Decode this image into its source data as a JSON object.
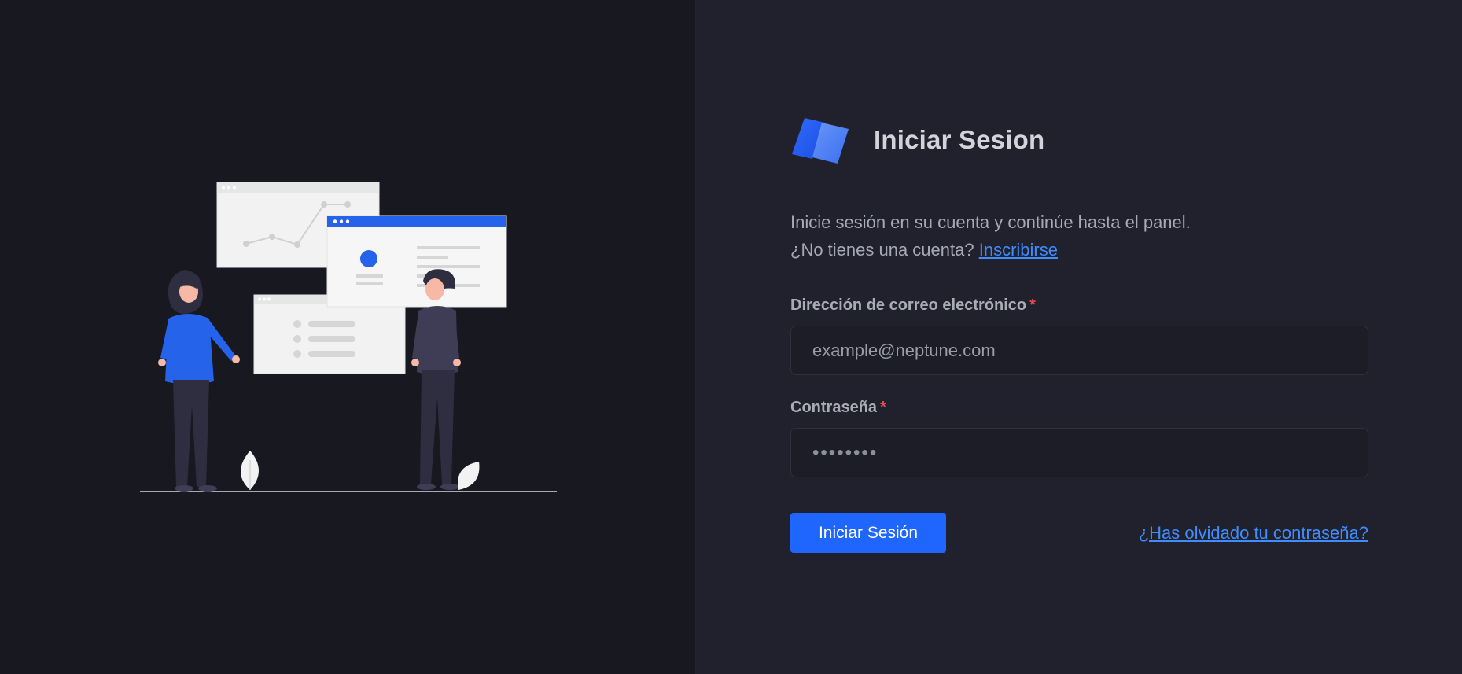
{
  "brand": {
    "title": "Iniciar Sesion",
    "logo_icon": "neptune-logo-icon",
    "accent_color": "#1f66ff"
  },
  "intro": {
    "line1": "Inicie sesión en su cuenta y continúe hasta el panel.",
    "line2_prefix": "¿No tienes una cuenta?",
    "signup_link": "Inscribirse"
  },
  "form": {
    "email": {
      "label": "Dirección de correo electrónico",
      "required_mark": "*",
      "placeholder": "example@neptune.com"
    },
    "password": {
      "label": "Contraseña",
      "required_mark": "*",
      "value_masked": "••••••••"
    },
    "submit_label": "Iniciar Sesión",
    "forgot_label": "¿Has olvidado tu contraseña?"
  }
}
